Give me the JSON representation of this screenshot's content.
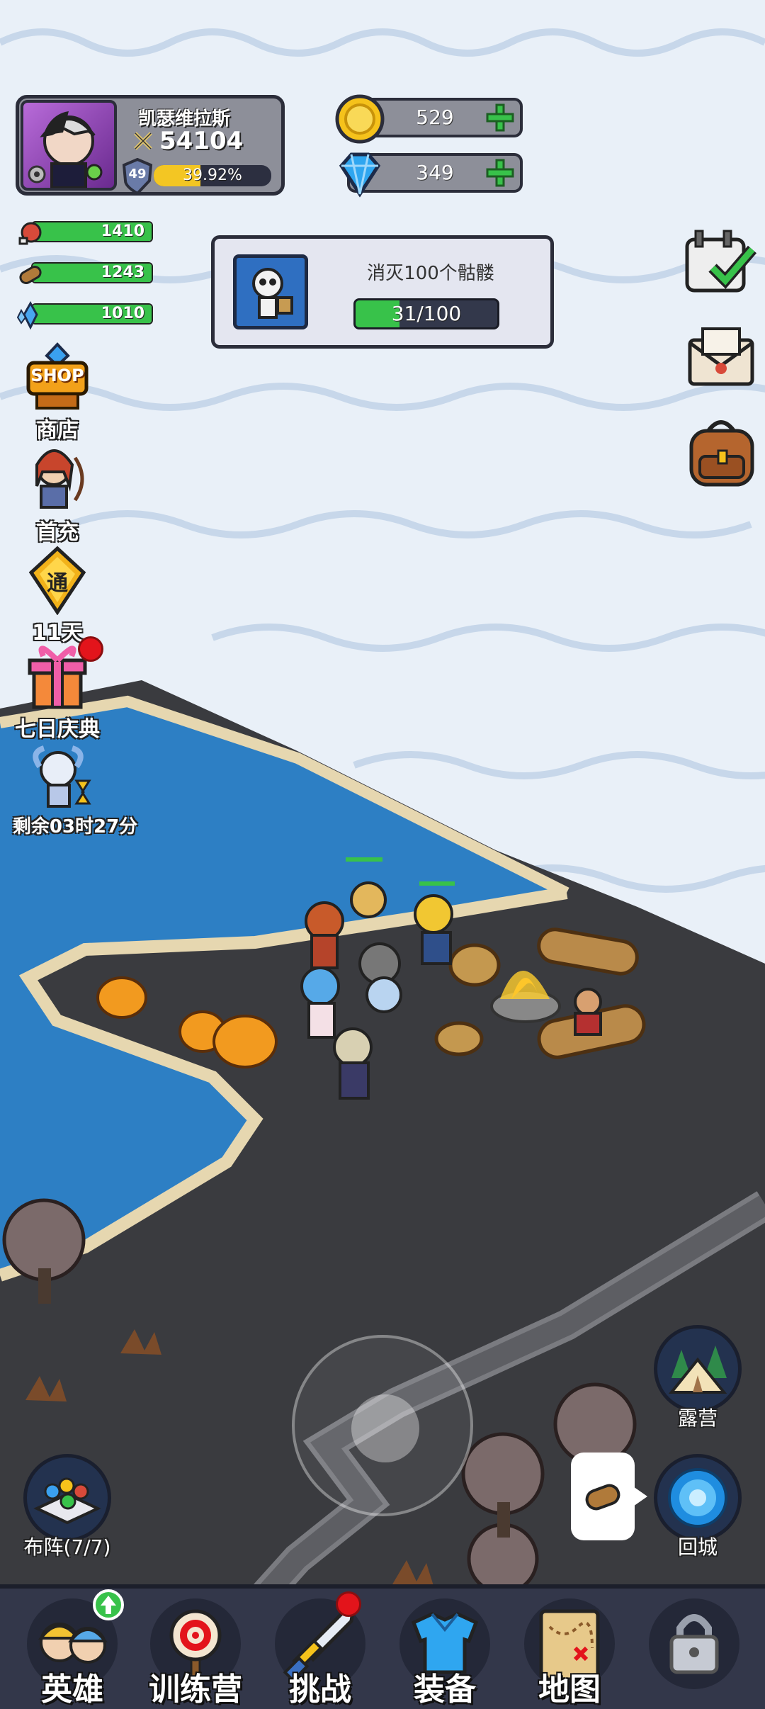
{
  "player": {
    "name": "凯瑟维拉斯",
    "power": "54104",
    "level": "49",
    "xp_text": "39.92%",
    "xp_fraction": 0.3992
  },
  "currencies": [
    {
      "name": "gold-coin-icon",
      "value": "529"
    },
    {
      "name": "diamond-icon",
      "value": "349"
    }
  ],
  "resources": [
    {
      "icon": "meat-icon",
      "value": "1410"
    },
    {
      "icon": "wood-log-icon",
      "value": "1243"
    },
    {
      "icon": "crystal-icon",
      "value": "1010"
    }
  ],
  "quest": {
    "title": "消灭100个骷髅",
    "progress_text": "31/100",
    "progress_fraction": 0.31
  },
  "side_menu": {
    "shop_badge": "SHOP",
    "shop": "商店",
    "first_recharge": "首充",
    "pass_badge": "通",
    "pass_days": "11天",
    "seven_day": "七日庆典",
    "remaining": "剩余03时27分"
  },
  "formation": "布阵(7/7)",
  "camp": "露营",
  "return_city": "回城",
  "nav": {
    "heroes": "英雄",
    "training": "训练营",
    "challenge": "挑战",
    "equipment": "装备",
    "map": "地图"
  },
  "colors": {
    "accent_green": "#38c24a",
    "xp_yellow": "#f3c623",
    "panel_dark": "#2b2d3a",
    "sea": "#2d7fc4",
    "ground": "#3a3b3f",
    "snow": "#e8f0f8"
  }
}
